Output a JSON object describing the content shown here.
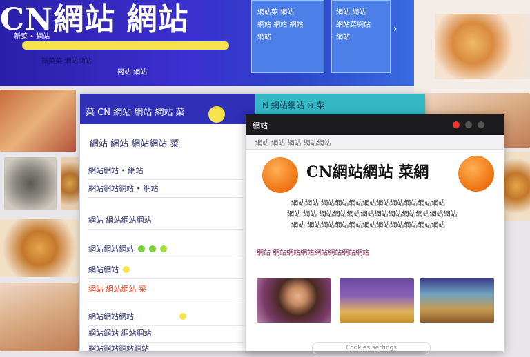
{
  "background": {
    "banner_title": "CN網站 網站",
    "banner_lines": [
      "新菜 • 網站",
      "新菜菜 網站網站",
      "网站 網站"
    ],
    "panel_left_lines": [
      "網站菜 網站",
      "網站 網站 網站",
      "網站"
    ],
    "panel_right_lines": [
      "網站 網站",
      "網站菜網站",
      "網站"
    ]
  },
  "back_card": {
    "nav_left": "菜  CN 網站  網站 網站  菜",
    "nav_right": "N  網站網站  ⊖  菜",
    "section_title": "網站 網站 網站網站  菜",
    "rows": [
      "網站網站  •  網站",
      "網站網站網站  •  網站",
      "網站 網站網站網站",
      "網站網站網站",
      "網站網站",
      "網站 網站網站 菜",
      "網站網站網站",
      "網站網站 網站網站",
      "網站網站網站網站"
    ],
    "accent": "#2f2fb8"
  },
  "window": {
    "tab_label": "網站",
    "url_text": "網站 網站  網站  網站網站",
    "headline": "CN網站網站  菜網",
    "body_lines": [
      "網站網站 網站網站網站網站網站網站網站網站網站",
      "網站 網站 網站網站網站網站網站網站網站網站網站網站",
      "網站 網站網站網站網站網站網站網站網站網站網站"
    ],
    "caption": "網站 網站網站網站網站網站網站網站",
    "footer_button": "Cookies settings",
    "orb_color": "#f07a19"
  }
}
